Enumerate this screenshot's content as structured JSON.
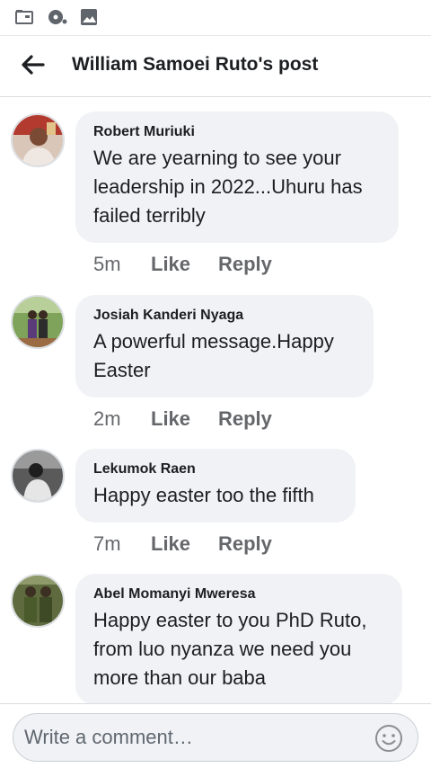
{
  "status_bar": {
    "icons": [
      "folder-icon",
      "disc-notification-icon",
      "image-icon"
    ]
  },
  "header": {
    "back_icon": "arrow-left-icon",
    "title": "William Samoei Ruto's post"
  },
  "comments": [
    {
      "author": "Robert Muriuki",
      "text": "We are yearning to see your leadership in 2022...Uhuru has failed terribly",
      "time": "5m",
      "like_label": "Like",
      "reply_label": "Reply"
    },
    {
      "author": "Josiah Kanderi Nyaga",
      "text": "A powerful message.Happy Easter",
      "time": "2m",
      "like_label": "Like",
      "reply_label": "Reply"
    },
    {
      "author": "Lekumok Raen",
      "text": "Happy easter too the fifth",
      "time": "7m",
      "like_label": "Like",
      "reply_label": "Reply"
    },
    {
      "author": "Abel Momanyi Mweresa",
      "text": "Happy easter to you PhD Ruto, from luo nyanza we need you more than our baba"
    }
  ],
  "composer": {
    "placeholder": "Write a comment…",
    "emoji_icon": "smiley-icon"
  },
  "colors": {
    "bubble": "#f0f2f5",
    "secondary_text": "#65676b",
    "primary_text": "#1c1e21"
  }
}
